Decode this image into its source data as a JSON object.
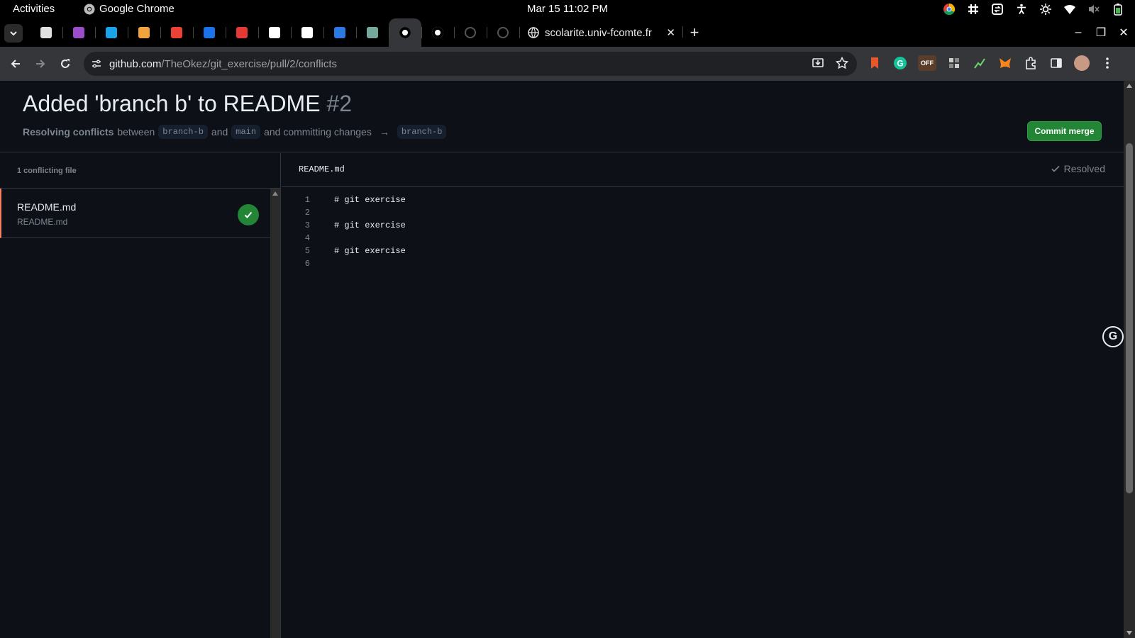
{
  "system": {
    "activities": "Activities",
    "app_name": "Google Chrome",
    "clock": "Mar 15  11:02 PM"
  },
  "browser": {
    "active_tab_title": "scolarite.univ-fcomte.fr",
    "url_host": "github.com",
    "url_path": "/TheOkez/git_exercise/pull/2/conflicts",
    "ext_badge": "OFF",
    "pinned_tabs": [
      {
        "icon": "notes-icon",
        "color": "#e0e0e0"
      },
      {
        "icon": "calendar-icon",
        "color": "#9b4dca"
      },
      {
        "icon": "c-app-icon",
        "color": "#1aa3e8"
      },
      {
        "icon": "photos-icon",
        "color": "#f2a33c"
      },
      {
        "icon": "gmail-icon",
        "color": "#ea4335"
      },
      {
        "icon": "contacts-icon",
        "color": "#1a73e8"
      },
      {
        "icon": "red-app-icon",
        "color": "#e53935"
      },
      {
        "icon": "triangle-app-icon",
        "color": "#ffffff"
      },
      {
        "icon": "x-icon",
        "color": "#ffffff"
      },
      {
        "icon": "drupal-icon",
        "color": "#2a7ae2"
      },
      {
        "icon": "chatgpt-icon",
        "color": "#74aa9c"
      },
      {
        "icon": "github-icon",
        "color": "#ffffff"
      },
      {
        "icon": "github-icon",
        "color": "#ffffff"
      },
      {
        "icon": "loading-icon",
        "color": "#555555"
      },
      {
        "icon": "loading-icon",
        "color": "#555555"
      }
    ]
  },
  "pr": {
    "title": "Added 'branch b' to README",
    "number": "#2",
    "sub_strong": "Resolving conflicts",
    "sub_between": "between",
    "head_branch": "branch-b",
    "sub_and": "and",
    "base_branch": "main",
    "sub_committing": "and committing changes",
    "arrow": "→",
    "target_branch": "branch-b",
    "commit_button": "Commit merge"
  },
  "sidebar": {
    "header": "1 conflicting file",
    "files": [
      {
        "name": "README.md",
        "path": "README.md",
        "status": "resolved"
      }
    ]
  },
  "editor": {
    "filename": "README.md",
    "status": "Resolved",
    "lines": [
      {
        "n": "1",
        "text": "# git exercise"
      },
      {
        "n": "2",
        "text": ""
      },
      {
        "n": "3",
        "text": "# git exercise"
      },
      {
        "n": "4",
        "text": ""
      },
      {
        "n": "5",
        "text": "# git exercise"
      },
      {
        "n": "6",
        "text": ""
      }
    ]
  },
  "colors": {
    "accent_green": "#238636",
    "conflict_border": "#f78166",
    "background": "#0d1117"
  }
}
